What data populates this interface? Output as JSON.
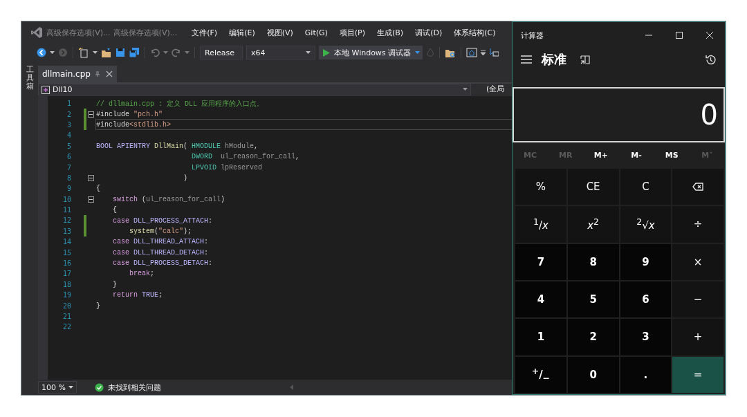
{
  "ide": {
    "title_items": [
      "高级保存选项(V)...",
      "高级保存选项(V)..."
    ],
    "menu": [
      "文件(F)",
      "编辑(E)",
      "视图(V)",
      "Git(G)",
      "项目(P)",
      "生成(B)",
      "调试(D)",
      "体系结构(C)"
    ],
    "toolbar": {
      "configuration": "Release",
      "platform": "x64",
      "run_label": "本地 Windows 调试器"
    },
    "toolbox_label": "工具箱",
    "tabs": [
      {
        "label": "dllmain.cpp",
        "selected": true
      }
    ],
    "nav": {
      "project": "Dll10",
      "scope": "(全局"
    },
    "code_lines": [
      {
        "number": "1",
        "fold": false,
        "changed": false,
        "current": false,
        "tokens": [
          {
            "kind": "comment",
            "text": "// dllmain.cpp : 定义 DLL 应用程序的入口点。"
          }
        ]
      },
      {
        "number": "2",
        "fold": true,
        "changed": true,
        "current": false,
        "tokens": [
          {
            "kind": "plain",
            "text": "#include "
          },
          {
            "kind": "string",
            "text": "\"pch.h\""
          }
        ]
      },
      {
        "number": "3",
        "fold": false,
        "changed": true,
        "current": true,
        "tokens": [
          {
            "kind": "plain",
            "text": "#include"
          },
          {
            "kind": "string",
            "text": "<stdlib.h>"
          }
        ]
      },
      {
        "number": "4",
        "fold": false,
        "changed": false,
        "current": false
      },
      {
        "number": "5",
        "fold": false,
        "changed": false,
        "current": false,
        "tokens": [
          {
            "kind": "macro",
            "text": "BOOL "
          },
          {
            "kind": "macro",
            "text": "APIENTRY "
          },
          {
            "kind": "func",
            "text": "DllMain"
          },
          {
            "kind": "plain",
            "text": "( "
          },
          {
            "kind": "type",
            "text": "HMODULE "
          },
          {
            "kind": "param",
            "text": "hModule"
          },
          {
            "kind": "plain",
            "text": ","
          }
        ]
      },
      {
        "number": "6",
        "fold": false,
        "changed": false,
        "current": false,
        "tokens": [
          {
            "kind": "type",
            "text": "                       DWORD  "
          },
          {
            "kind": "param",
            "text": "ul_reason_for_call"
          },
          {
            "kind": "plain",
            "text": ","
          }
        ]
      },
      {
        "number": "7",
        "fold": false,
        "changed": false,
        "current": false,
        "tokens": [
          {
            "kind": "type",
            "text": "                       LPVOID "
          },
          {
            "kind": "param",
            "text": "lpReserved"
          }
        ]
      },
      {
        "number": "8",
        "fold": true,
        "changed": false,
        "current": false,
        "tokens": [
          {
            "kind": "plain",
            "text": "                     )"
          }
        ]
      },
      {
        "number": "9",
        "fold": false,
        "changed": false,
        "current": false,
        "tokens": [
          {
            "kind": "plain",
            "text": "{"
          }
        ]
      },
      {
        "number": "10",
        "fold": true,
        "changed": false,
        "current": false,
        "tokens": [
          {
            "kind": "keyword",
            "text": "    switch"
          },
          {
            "kind": "plain",
            "text": " ("
          },
          {
            "kind": "param",
            "text": "ul_reason_for_call"
          },
          {
            "kind": "plain",
            "text": ")"
          }
        ]
      },
      {
        "number": "11",
        "fold": false,
        "changed": false,
        "current": false,
        "tokens": [
          {
            "kind": "plain",
            "text": "    {"
          }
        ]
      },
      {
        "number": "12",
        "fold": false,
        "changed": true,
        "current": false,
        "tokens": [
          {
            "kind": "keyword",
            "text": "    case "
          },
          {
            "kind": "macro",
            "text": "DLL_PROCESS_ATTACH"
          },
          {
            "kind": "plain",
            "text": ":"
          }
        ]
      },
      {
        "number": "13",
        "fold": false,
        "changed": true,
        "current": false,
        "tokens": [
          {
            "kind": "func",
            "text": "        system"
          },
          {
            "kind": "plain",
            "text": "("
          },
          {
            "kind": "string",
            "text": "\"calc\""
          },
          {
            "kind": "plain",
            "text": ");"
          }
        ]
      },
      {
        "number": "14",
        "fold": false,
        "changed": false,
        "current": false,
        "tokens": [
          {
            "kind": "keyword",
            "text": "    case "
          },
          {
            "kind": "macro",
            "text": "DLL_THREAD_ATTACH"
          },
          {
            "kind": "plain",
            "text": ":"
          }
        ]
      },
      {
        "number": "15",
        "fold": false,
        "changed": false,
        "current": false,
        "tokens": [
          {
            "kind": "keyword",
            "text": "    case "
          },
          {
            "kind": "macro",
            "text": "DLL_THREAD_DETACH"
          },
          {
            "kind": "plain",
            "text": ":"
          }
        ]
      },
      {
        "number": "16",
        "fold": false,
        "changed": false,
        "current": false,
        "tokens": [
          {
            "kind": "keyword",
            "text": "    case "
          },
          {
            "kind": "macro",
            "text": "DLL_PROCESS_DETACH"
          },
          {
            "kind": "plain",
            "text": ":"
          }
        ]
      },
      {
        "number": "17",
        "fold": false,
        "changed": false,
        "current": false,
        "tokens": [
          {
            "kind": "keyword",
            "text": "        break"
          },
          {
            "kind": "plain",
            "text": ";"
          }
        ]
      },
      {
        "number": "18",
        "fold": false,
        "changed": false,
        "current": false,
        "tokens": [
          {
            "kind": "plain",
            "text": "    }"
          }
        ]
      },
      {
        "number": "19",
        "fold": false,
        "changed": false,
        "current": false,
        "tokens": [
          {
            "kind": "keyword",
            "text": "    return "
          },
          {
            "kind": "macro",
            "text": "TRUE"
          },
          {
            "kind": "plain",
            "text": ";"
          }
        ]
      },
      {
        "number": "20",
        "fold": false,
        "changed": false,
        "current": false,
        "tokens": [
          {
            "kind": "plain",
            "text": "}"
          }
        ]
      },
      {
        "number": "21",
        "fold": false,
        "changed": false,
        "current": false
      },
      {
        "number": "22",
        "fold": false,
        "changed": false,
        "current": false
      }
    ],
    "status": {
      "zoom": "100 %",
      "message": "未找到相关问题"
    }
  },
  "calculator": {
    "title": "计算器",
    "mode": "标准",
    "display": "0",
    "memory": [
      {
        "label": "MC",
        "disabled": true
      },
      {
        "label": "MR",
        "disabled": true
      },
      {
        "label": "M+",
        "disabled": false
      },
      {
        "label": "M-",
        "disabled": false
      },
      {
        "label": "MS",
        "disabled": false
      },
      {
        "label": "M˅",
        "disabled": true
      }
    ],
    "keys": [
      {
        "kind": "function",
        "label": "%"
      },
      {
        "kind": "function",
        "label": "CE"
      },
      {
        "kind": "function",
        "label": "C"
      },
      {
        "kind": "backspace"
      },
      {
        "kind": "function",
        "label": "$^{1}$/*x*"
      },
      {
        "kind": "function",
        "label": "*x*$^{2}$"
      },
      {
        "kind": "function",
        "label": "$^{2}$√*x*"
      },
      {
        "kind": "operator",
        "label": "÷"
      },
      {
        "kind": "digit",
        "label": "7"
      },
      {
        "kind": "digit",
        "label": "8"
      },
      {
        "kind": "digit",
        "label": "9"
      },
      {
        "kind": "operator",
        "label": "×"
      },
      {
        "kind": "digit",
        "label": "4"
      },
      {
        "kind": "digit",
        "label": "5"
      },
      {
        "kind": "digit",
        "label": "6"
      },
      {
        "kind": "operator",
        "label": "−"
      },
      {
        "kind": "digit",
        "label": "1"
      },
      {
        "kind": "digit",
        "label": "2"
      },
      {
        "kind": "digit",
        "label": "3"
      },
      {
        "kind": "operator",
        "label": "+"
      },
      {
        "kind": "digit",
        "label": "$^{+}$/$_{−}$"
      },
      {
        "kind": "digit",
        "label": "0"
      },
      {
        "kind": "digit",
        "label": "."
      },
      {
        "kind": "equals",
        "label": "="
      }
    ]
  }
}
